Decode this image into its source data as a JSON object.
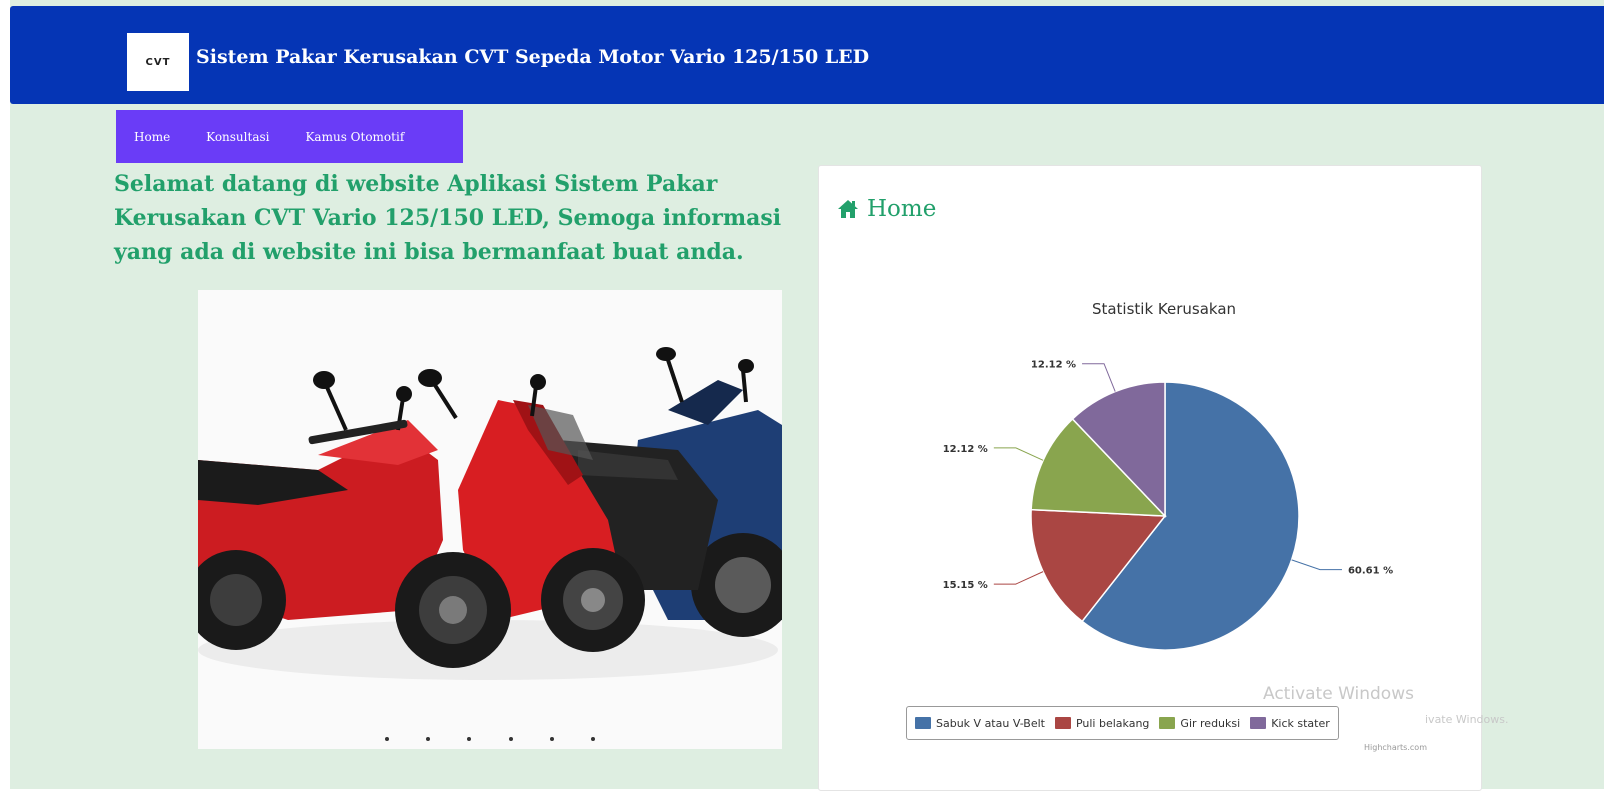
{
  "header": {
    "logo_text": "CVT",
    "title": "Sistem Pakar Kerusakan CVT Sepeda Motor Vario 125/150 LED"
  },
  "nav": {
    "items": [
      {
        "label": "Home"
      },
      {
        "label": "Konsultasi"
      },
      {
        "label": "Kamus Otomotif"
      }
    ]
  },
  "welcome_text": "Selamat datang di website Aplikasi Sistem Pakar Kerusakan CVT Vario 125/150 LED, Semoga informasi yang ada di website ini bisa bermanfaat buat anda.",
  "carousel": {
    "slide_count": 6,
    "image_desc": "motorcycles-icon"
  },
  "panel": {
    "title": "Home",
    "icon": "home-icon"
  },
  "chart_data": {
    "type": "pie",
    "title": "Statistik Kerusakan",
    "series": [
      {
        "name": "Sabuk V atau V-Belt",
        "value": 60.61,
        "label": "60.61 %",
        "color": "#4572a7"
      },
      {
        "name": "Puli belakang",
        "value": 15.15,
        "label": "15.15 %",
        "color": "#aa4643"
      },
      {
        "name": "Gir reduksi",
        "value": 12.12,
        "label": "12.12 %",
        "color": "#89a54e"
      },
      {
        "name": "Kick stater",
        "value": 12.12,
        "label": "12.12 %",
        "color": "#80699b"
      }
    ],
    "legend_position": "bottom",
    "credits": "Highcharts.com"
  },
  "watermark": {
    "title": "Activate Windows",
    "subtitle": "ivate Windows."
  }
}
